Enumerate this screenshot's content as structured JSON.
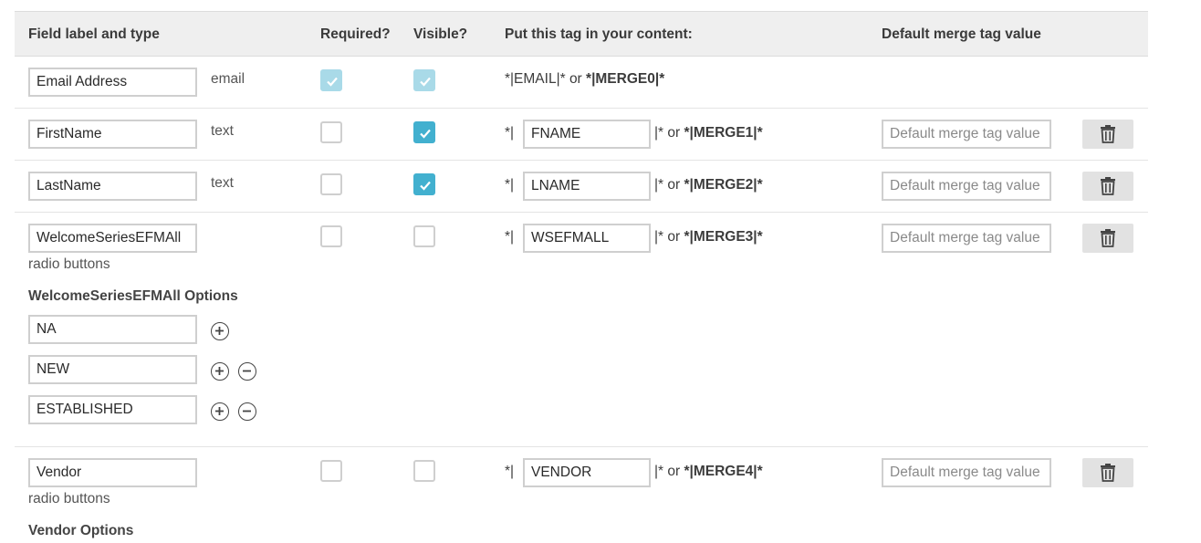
{
  "header": {
    "col_label": "Field label and type",
    "col_required": "Required?",
    "col_visible": "Visible?",
    "col_tag": "Put this tag in your content:",
    "col_default": "Default merge tag value"
  },
  "fields": [
    {
      "label": "Email Address",
      "type": "email",
      "required": true,
      "visible": true,
      "locked": true,
      "tag_text": "*|EMAIL|* or ",
      "merge": "*|MERGE0|*"
    },
    {
      "label": "FirstName",
      "type": "text",
      "required": false,
      "visible": true,
      "tag": "FNAME",
      "merge": "*|MERGE1|*",
      "default_placeholder": "Default merge tag value"
    },
    {
      "label": "LastName",
      "type": "text",
      "required": false,
      "visible": true,
      "tag": "LNAME",
      "merge": "*|MERGE2|*",
      "default_placeholder": "Default merge tag value"
    },
    {
      "label": "WelcomeSeriesEFMAll",
      "type": "radio buttons",
      "required": false,
      "visible": false,
      "tag": "WSEFMALL",
      "merge": "*|MERGE3|*",
      "default_placeholder": "Default merge tag value",
      "options_title": "WelcomeSeriesEFMAll Options",
      "options": [
        "NA",
        "NEW",
        "ESTABLISHED"
      ]
    },
    {
      "label": "Vendor",
      "type": "radio buttons",
      "required": false,
      "visible": false,
      "tag": "VENDOR",
      "merge": "*|MERGE4|*",
      "default_placeholder": "Default merge tag value",
      "options_title": "Vendor Options"
    }
  ],
  "tag_prefix": "*|",
  "tag_suffix": "|* or ",
  "icons": {
    "delete": "trash-icon",
    "add": "plus-circle-icon",
    "remove": "minus-circle-icon",
    "check": "check-icon"
  },
  "colors": {
    "checkbox_on": "#42b0cf",
    "checkbox_locked": "#a9dae8",
    "header_bg": "#efefef"
  }
}
